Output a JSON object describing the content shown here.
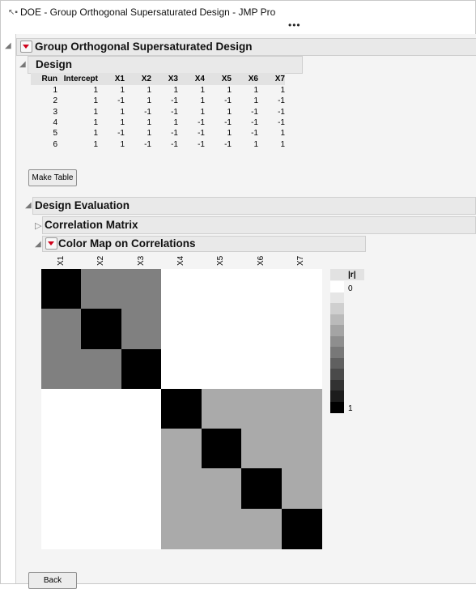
{
  "window": {
    "title": "DOE - Group Orthogonal Supersaturated Design - JMP Pro",
    "icon_name": "jmp-doc-icon",
    "more_menu": "•••"
  },
  "report": {
    "title": "Group Orthogonal Supersaturated Design",
    "design": {
      "title": "Design",
      "columns": [
        "Run",
        "Intercept",
        "X1",
        "X2",
        "X3",
        "X4",
        "X5",
        "X6",
        "X7"
      ],
      "rows": [
        [
          "1",
          "1",
          "1",
          "1",
          "1",
          "1",
          "1",
          "1",
          "1"
        ],
        [
          "2",
          "1",
          "-1",
          "1",
          "-1",
          "1",
          "-1",
          "1",
          "-1"
        ],
        [
          "3",
          "1",
          "1",
          "-1",
          "-1",
          "1",
          "1",
          "-1",
          "-1"
        ],
        [
          "4",
          "1",
          "1",
          "1",
          "1",
          "-1",
          "-1",
          "-1",
          "-1"
        ],
        [
          "5",
          "1",
          "-1",
          "1",
          "-1",
          "-1",
          "1",
          "-1",
          "1"
        ],
        [
          "6",
          "1",
          "1",
          "-1",
          "-1",
          "-1",
          "-1",
          "1",
          "1"
        ]
      ],
      "make_table_label": "Make Table"
    },
    "evaluation": {
      "title": "Design Evaluation",
      "correlation_matrix_title": "Correlation Matrix",
      "color_map": {
        "title": "Color Map on Correlations",
        "factors": [
          "X1",
          "X2",
          "X3",
          "X4",
          "X5",
          "X6",
          "X7"
        ],
        "abs_correlation": [
          [
            1,
            0.5,
            0.5,
            0,
            0,
            0,
            0
          ],
          [
            0.5,
            1,
            0.5,
            0,
            0,
            0,
            0
          ],
          [
            0.5,
            0.5,
            1,
            0,
            0,
            0,
            0
          ],
          [
            0,
            0,
            0,
            1,
            0.333,
            0.333,
            0.333
          ],
          [
            0,
            0,
            0,
            0.333,
            1,
            0.333,
            0.333
          ],
          [
            0,
            0,
            0,
            0.333,
            0.333,
            1,
            0.333
          ],
          [
            0,
            0,
            0,
            0.333,
            0.333,
            0.333,
            1
          ]
        ],
        "legend_header": "|r|",
        "legend_min": "0",
        "legend_max": "1",
        "legend_colors": [
          "#ffffff",
          "#e6e6e6",
          "#cfcfcf",
          "#bababa",
          "#a4a4a4",
          "#8e8e8e",
          "#787878",
          "#606060",
          "#4a4a4a",
          "#323232",
          "#1c1c1c",
          "#000000"
        ]
      }
    },
    "back_label": "Back"
  }
}
